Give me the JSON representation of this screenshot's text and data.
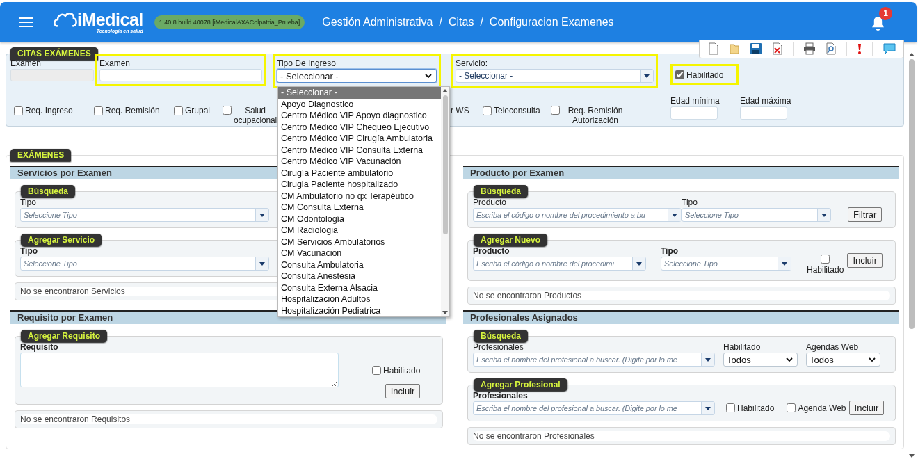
{
  "header": {
    "brand": "iMedical",
    "tagline": "Tecnología en salud",
    "version": "1.40.8 build 40078 [iMedicalAXAColpatria_Prueba]",
    "separator": "/",
    "breadcrumb": [
      "Gestión Administrativa",
      "Citas",
      "Configuracion Examenes"
    ],
    "notification_count": "1"
  },
  "citas": {
    "legend": "CITAS EXÁMENES",
    "examen_code": {
      "label": "Examen",
      "disabled": true
    },
    "examen_name": {
      "label": "Examen",
      "highlighted": true
    },
    "tipo_ingreso": {
      "label": "Tipo De Ingreso",
      "value": "- Seleccionar -",
      "highlighted": true,
      "expanded": true,
      "options": [
        {
          "label": "- Seleccionar -",
          "selected": true
        },
        {
          "label": "Apoyo Diagnostico",
          "selected": false
        },
        {
          "label": "Centro Médico VIP Apoyo diagnostico",
          "selected": false
        },
        {
          "label": "Centro Médico VIP Chequeo Ejecutivo",
          "selected": false
        },
        {
          "label": "Centro Médico VIP Cirugía Ambulatoria",
          "selected": false
        },
        {
          "label": "Centro Médico VIP Consulta Externa",
          "selected": false
        },
        {
          "label": "Centro Médico VIP Vacunación",
          "selected": false
        },
        {
          "label": "Cirugía Paciente ambulatorio",
          "selected": false
        },
        {
          "label": "Cirugia Paciente hospitalizado",
          "selected": false
        },
        {
          "label": "CM Ambulatorio no qx Terapéutico",
          "selected": false
        },
        {
          "label": "CM Consulta Externa",
          "selected": false
        },
        {
          "label": "CM Odontología",
          "selected": false
        },
        {
          "label": "CM Radiologia",
          "selected": false
        },
        {
          "label": "CM Servicios Ambulatorios",
          "selected": false
        },
        {
          "label": "CM Vacunacion",
          "selected": false
        },
        {
          "label": "Consulta Ambulatoria",
          "selected": false
        },
        {
          "label": "Consulta Anestesia",
          "selected": false
        },
        {
          "label": "Consulta Externa Alsacia",
          "selected": false
        },
        {
          "label": "Hospitalización Adultos",
          "selected": false
        },
        {
          "label": "Hospitalización Pediatrica",
          "selected": false
        }
      ]
    },
    "servicio": {
      "label": "Servicio:",
      "value": "- Seleccionar -",
      "highlighted": true
    },
    "habilitado": {
      "label": "Habilitado",
      "checked": true,
      "highlighted": true
    },
    "checkboxes": [
      {
        "label": "Req. Ingreso",
        "checked": false
      },
      {
        "label": "Req. Remisión",
        "checked": false
      },
      {
        "label": "Grupal",
        "checked": false
      },
      {
        "label": "Salud ocupacional",
        "checked": false
      },
      {
        "label": "r WS"
      },
      {
        "label": "Teleconsulta",
        "checked": false
      },
      {
        "label": "Req. Remisión Autorización",
        "checked": false
      }
    ],
    "edad_minima": {
      "label": "Edad mínima"
    },
    "edad_maxima": {
      "label": "Edad máxima"
    }
  },
  "examenes": {
    "legend": "EXÁMENES",
    "servicios": {
      "title": "Servicios por Examen",
      "busqueda": {
        "legend": "Búsqueda",
        "tipo": {
          "label": "Tipo",
          "placeholder": "Seleccione Tipo"
        }
      },
      "agregar": {
        "legend": "Agregar Servicio",
        "tipo": {
          "label": "Tipo",
          "placeholder": "Seleccione Tipo"
        }
      },
      "empty": "No se encontraron Servicios"
    },
    "requisitos": {
      "title": "Requisito por Examen",
      "agregar": {
        "legend": "Agregar Requisito",
        "requisito": {
          "label": "Requisito"
        },
        "habilitado": {
          "label": "Habilitado",
          "checked": false
        },
        "button": "Incluir"
      },
      "empty": "No se encontraron Requisitos"
    },
    "productos": {
      "title": "Producto por Examen",
      "busqueda": {
        "legend": "Búsqueda",
        "producto": {
          "label": "Producto",
          "placeholder": "Escriba el código o nombre del procedimiento a bu"
        },
        "tipo": {
          "label": "Tipo",
          "placeholder": "Seleccione Tipo"
        },
        "button": "Filtrar"
      },
      "agregar": {
        "legend": "Agregar Nuevo",
        "producto": {
          "label": "Producto",
          "placeholder": "Escriba el código o nombre del procedimi"
        },
        "tipo": {
          "label": "Tipo",
          "placeholder": "Seleccione Tipo"
        },
        "habilitado": {
          "label": "Habilitado",
          "checked": false
        },
        "button": "Incluir"
      },
      "empty": "No se encontraron Productos"
    },
    "profesionales": {
      "title": "Profesionales Asignados",
      "busqueda": {
        "legend": "Búsqueda",
        "profesionales": {
          "label": "Profesionales",
          "placeholder": "Escriba el nombre del profesional a buscar. (Digite por lo me"
        },
        "habilitado": {
          "label": "Habilitado",
          "value": "Todos"
        },
        "agendas": {
          "label": "Agendas Web",
          "value": "Todos"
        }
      },
      "agregar": {
        "legend": "Agregar Profesional",
        "profesionales": {
          "label": "Profesionales",
          "placeholder": "Escriba el nombre del profesional a buscar. (Digite por lo me"
        },
        "habilitado": {
          "label": "Habilitado",
          "checked": false
        },
        "agenda_web": {
          "label": "Agenda Web",
          "checked": false
        },
        "button": "Incluir"
      },
      "empty": "No se encontraron Profesionales"
    }
  }
}
